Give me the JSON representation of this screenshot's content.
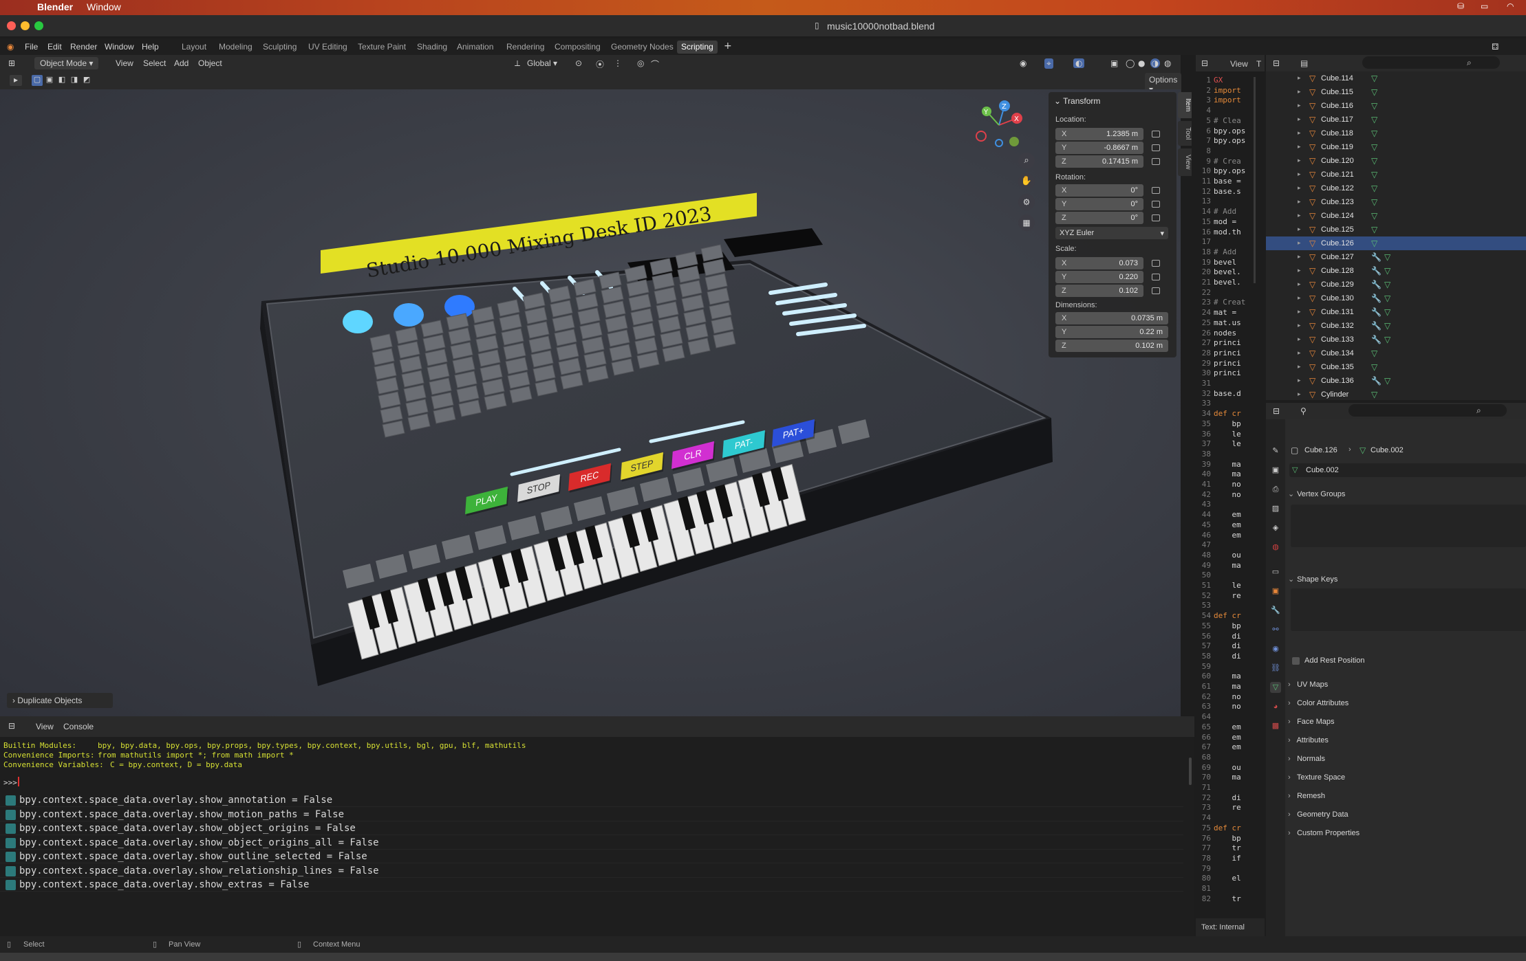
{
  "os_menu": {
    "app": "Blender",
    "window": "Window"
  },
  "window_title": "music10000notbad.blend",
  "top_menu": [
    "File",
    "Edit",
    "Render",
    "Window",
    "Help"
  ],
  "workspaces": [
    "Layout",
    "Modeling",
    "Sculpting",
    "UV Editing",
    "Texture Paint",
    "Shading",
    "Animation",
    "Rendering",
    "Compositing",
    "Geometry Nodes",
    "Scripting"
  ],
  "active_workspace": "Scripting",
  "viewport_header": {
    "mode": "Object Mode",
    "menus": [
      "View",
      "Select",
      "Add",
      "Object"
    ],
    "transform_orientation": "Global",
    "options": "Options"
  },
  "scene": {
    "banner_text": "Studio 10.000 Mixing Desk ID 2023",
    "buttons": [
      {
        "label": "PLAY",
        "color": "#3db23a"
      },
      {
        "label": "STOP",
        "color": "#d9d9d9"
      },
      {
        "label": "REC",
        "color": "#d92b2b"
      },
      {
        "label": "STEP",
        "color": "#e2d52c"
      },
      {
        "label": "CLR",
        "color": "#d12fd1"
      },
      {
        "label": "PAT-",
        "color": "#2ec9d0"
      },
      {
        "label": "PAT+",
        "color": "#2b4fd9"
      }
    ],
    "operator_panel": "Duplicate Objects"
  },
  "transform": {
    "title": "Transform",
    "location_label": "Location:",
    "location": [
      {
        "axis": "X",
        "value": "1.2385 m"
      },
      {
        "axis": "Y",
        "value": "-0.8667 m"
      },
      {
        "axis": "Z",
        "value": "0.17415 m"
      }
    ],
    "rotation_label": "Rotation:",
    "rotation": [
      {
        "axis": "X",
        "value": "0°"
      },
      {
        "axis": "Y",
        "value": "0°"
      },
      {
        "axis": "Z",
        "value": "0°"
      }
    ],
    "rotation_mode": "XYZ Euler",
    "scale_label": "Scale:",
    "scale": [
      {
        "axis": "X",
        "value": "0.073"
      },
      {
        "axis": "Y",
        "value": "0.220"
      },
      {
        "axis": "Z",
        "value": "0.102"
      }
    ],
    "dimensions_label": "Dimensions:",
    "dimensions": [
      {
        "axis": "X",
        "value": "0.0735 m"
      },
      {
        "axis": "Y",
        "value": "0.22 m"
      },
      {
        "axis": "Z",
        "value": "0.102 m"
      }
    ]
  },
  "side_tabs": [
    "Item",
    "Tool",
    "View"
  ],
  "console": {
    "header_menus": [
      "View",
      "Console"
    ],
    "builtin_label": "Builtin Modules:",
    "builtin_value": "bpy, bpy.data, bpy.ops, bpy.props, bpy.types, bpy.context, bpy.utils, bgl, gpu, blf, mathutils",
    "imports_label": "Convenience Imports:",
    "imports_value": "from mathutils import *; from math import *",
    "vars_label": "Convenience Variables:",
    "vars_value": "C = bpy.context, D = bpy.data",
    "prompt": ">>>",
    "history": [
      "bpy.context.space_data.overlay.show_annotation = False",
      "bpy.context.space_data.overlay.show_motion_paths = False",
      "bpy.context.space_data.overlay.show_object_origins = False",
      "bpy.context.space_data.overlay.show_object_origins_all = False",
      "bpy.context.space_data.overlay.show_outline_selected = False",
      "bpy.context.space_data.overlay.show_relationship_lines = False",
      "bpy.context.space_data.overlay.show_extras = False"
    ]
  },
  "text_editor": {
    "header_view": "View",
    "header_t": "T",
    "footer": "Text: Internal",
    "lines": [
      {
        "n": "1",
        "t": "GX"
      },
      {
        "n": "2",
        "t": "import"
      },
      {
        "n": "3",
        "t": "import"
      },
      {
        "n": "4",
        "t": ""
      },
      {
        "n": "5",
        "t": "# Clea"
      },
      {
        "n": "6",
        "t": "bpy.ops"
      },
      {
        "n": "7",
        "t": "bpy.ops"
      },
      {
        "n": "8",
        "t": ""
      },
      {
        "n": "9",
        "t": "# Crea"
      },
      {
        "n": "10",
        "t": "bpy.ops"
      },
      {
        "n": "11",
        "t": "base ="
      },
      {
        "n": "12",
        "t": "base.s"
      },
      {
        "n": "13",
        "t": ""
      },
      {
        "n": "14",
        "t": "# Add "
      },
      {
        "n": "15",
        "t": "mod = "
      },
      {
        "n": "16",
        "t": "mod.th"
      },
      {
        "n": "17",
        "t": ""
      },
      {
        "n": "18",
        "t": "# Add "
      },
      {
        "n": "19",
        "t": "bevel "
      },
      {
        "n": "20",
        "t": "bevel."
      },
      {
        "n": "21",
        "t": "bevel."
      },
      {
        "n": "22",
        "t": ""
      },
      {
        "n": "23",
        "t": "# Creat"
      },
      {
        "n": "24",
        "t": "mat = "
      },
      {
        "n": "25",
        "t": "mat.us"
      },
      {
        "n": "26",
        "t": "nodes "
      },
      {
        "n": "27",
        "t": "princi"
      },
      {
        "n": "28",
        "t": "princi"
      },
      {
        "n": "29",
        "t": "princi"
      },
      {
        "n": "30",
        "t": "princi"
      },
      {
        "n": "31",
        "t": ""
      },
      {
        "n": "32",
        "t": "base.d"
      },
      {
        "n": "33",
        "t": ""
      },
      {
        "n": "34",
        "t": "def cr"
      },
      {
        "n": "35",
        "t": "    bp"
      },
      {
        "n": "36",
        "t": "    le"
      },
      {
        "n": "37",
        "t": "    le"
      },
      {
        "n": "38",
        "t": ""
      },
      {
        "n": "39",
        "t": "    ma"
      },
      {
        "n": "40",
        "t": "    ma"
      },
      {
        "n": "41",
        "t": "    no"
      },
      {
        "n": "42",
        "t": "    no"
      },
      {
        "n": "43",
        "t": ""
      },
      {
        "n": "44",
        "t": "    em"
      },
      {
        "n": "45",
        "t": "    em"
      },
      {
        "n": "46",
        "t": "    em"
      },
      {
        "n": "47",
        "t": ""
      },
      {
        "n": "48",
        "t": "    ou"
      },
      {
        "n": "49",
        "t": "    ma"
      },
      {
        "n": "50",
        "t": ""
      },
      {
        "n": "51",
        "t": "    le"
      },
      {
        "n": "52",
        "t": "    re"
      },
      {
        "n": "53",
        "t": ""
      },
      {
        "n": "54",
        "t": "def cr"
      },
      {
        "n": "55",
        "t": "    bp"
      },
      {
        "n": "56",
        "t": "    di"
      },
      {
        "n": "57",
        "t": "    di"
      },
      {
        "n": "58",
        "t": "    di"
      },
      {
        "n": "59",
        "t": ""
      },
      {
        "n": "60",
        "t": "    ma"
      },
      {
        "n": "61",
        "t": "    ma"
      },
      {
        "n": "62",
        "t": "    no"
      },
      {
        "n": "63",
        "t": "    no"
      },
      {
        "n": "64",
        "t": ""
      },
      {
        "n": "65",
        "t": "    em"
      },
      {
        "n": "66",
        "t": "    em"
      },
      {
        "n": "67",
        "t": "    em"
      },
      {
        "n": "68",
        "t": ""
      },
      {
        "n": "69",
        "t": "    ou"
      },
      {
        "n": "70",
        "t": "    ma"
      },
      {
        "n": "71",
        "t": ""
      },
      {
        "n": "72",
        "t": "    di"
      },
      {
        "n": "73",
        "t": "    re"
      },
      {
        "n": "74",
        "t": ""
      },
      {
        "n": "75",
        "t": "def cr"
      },
      {
        "n": "76",
        "t": "    bp"
      },
      {
        "n": "77",
        "t": "    tr"
      },
      {
        "n": "78",
        "t": "    if"
      },
      {
        "n": "79",
        "t": ""
      },
      {
        "n": "80",
        "t": "    el"
      },
      {
        "n": "81",
        "t": ""
      },
      {
        "n": "82",
        "t": "    tr"
      }
    ]
  },
  "outliner": {
    "rows": [
      {
        "name": "Cube.114",
        "sel": false,
        "mods": 0
      },
      {
        "name": "Cube.115",
        "sel": false,
        "mods": 0
      },
      {
        "name": "Cube.116",
        "sel": false,
        "mods": 0
      },
      {
        "name": "Cube.117",
        "sel": false,
        "mods": 0
      },
      {
        "name": "Cube.118",
        "sel": false,
        "mods": 0
      },
      {
        "name": "Cube.119",
        "sel": false,
        "mods": 0
      },
      {
        "name": "Cube.120",
        "sel": false,
        "mods": 0
      },
      {
        "name": "Cube.121",
        "sel": false,
        "mods": 0
      },
      {
        "name": "Cube.122",
        "sel": false,
        "mods": 0
      },
      {
        "name": "Cube.123",
        "sel": false,
        "mods": 0
      },
      {
        "name": "Cube.124",
        "sel": false,
        "mods": 0
      },
      {
        "name": "Cube.125",
        "sel": false,
        "mods": 0
      },
      {
        "name": "Cube.126",
        "sel": true,
        "mods": 0
      },
      {
        "name": "Cube.127",
        "sel": false,
        "mods": 1
      },
      {
        "name": "Cube.128",
        "sel": false,
        "mods": 1
      },
      {
        "name": "Cube.129",
        "sel": false,
        "mods": 1
      },
      {
        "name": "Cube.130",
        "sel": false,
        "mods": 1
      },
      {
        "name": "Cube.131",
        "sel": false,
        "mods": 1
      },
      {
        "name": "Cube.132",
        "sel": false,
        "mods": 1
      },
      {
        "name": "Cube.133",
        "sel": false,
        "mods": 1
      },
      {
        "name": "Cube.134",
        "sel": false,
        "mods": 0
      },
      {
        "name": "Cube.135",
        "sel": false,
        "mods": 0
      },
      {
        "name": "Cube.136",
        "sel": false,
        "mods": 1
      },
      {
        "name": "Cylinder",
        "sel": false,
        "mods": 0
      }
    ]
  },
  "properties": {
    "breadcrumb_object": "Cube.126",
    "breadcrumb_mesh": "Cube.002",
    "mesh_name": "Cube.002",
    "vertex_groups": "Vertex Groups",
    "shape_keys": "Shape Keys",
    "add_rest_position": "Add Rest Position",
    "sections": [
      "UV Maps",
      "Color Attributes",
      "Face Maps",
      "Attributes",
      "Normals",
      "Texture Space",
      "Remesh",
      "Geometry Data",
      "Custom Properties"
    ]
  },
  "status_bar": {
    "select": "Select",
    "pan": "Pan View",
    "context": "Context Menu"
  },
  "colors": {
    "accent_selected": "#334d80",
    "banner": "#e3e024",
    "glow": "#bfefff",
    "mesh_icon": "#e8873a",
    "mesh_data_icon": "#5bbf76"
  }
}
